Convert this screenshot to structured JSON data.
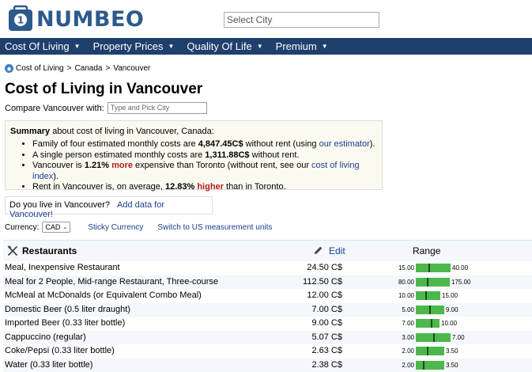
{
  "header": {
    "logo_text": "NUMBEO",
    "select_city_placeholder": "Select City"
  },
  "nav": [
    {
      "label": "Cost Of Living"
    },
    {
      "label": "Property Prices"
    },
    {
      "label": "Quality Of Life"
    },
    {
      "label": "Premium"
    }
  ],
  "breadcrumb": [
    "Cost of Living",
    "Canada",
    "Vancouver"
  ],
  "page_title": "Cost of Living in Vancouver",
  "compare": {
    "label": "Compare Vancouver with:",
    "placeholder": "Type and Pick City"
  },
  "summary": {
    "head_bold": "Summary",
    "head_rest": " about cost of living in Vancouver, Canada:",
    "b1_pre": "Family of four estimated monthly costs are ",
    "b1_value": "4,847.45C$",
    "b1_mid": " without rent (using ",
    "b1_link": "our estimator",
    "b1_post": ").",
    "b2_pre": "A single person estimated monthly costs are ",
    "b2_value": "1,311.88C$",
    "b2_post": " without rent.",
    "b3_pre": "Vancouver is ",
    "b3_pct": "1.21%",
    "b3_word": "more",
    "b3_mid": " expensive than Toronto (without rent, see our ",
    "b3_link": "cost of living index",
    "b3_post": ").",
    "b4_pre": "Rent in Vancouver is, on average, ",
    "b4_pct": "12.83%",
    "b4_word": "higher",
    "b4_post": " than in Toronto."
  },
  "live_box": {
    "question": "Do you live in Vancouver?",
    "link": "Add data for Vancouver!"
  },
  "currency": {
    "label": "Currency:",
    "selected": "CAD",
    "sticky_link": "Sticky Currency",
    "units_link": "Switch to US measurement units"
  },
  "table": {
    "section_title": "Restaurants",
    "edit_label": "Edit",
    "range_label": "Range",
    "rows": [
      {
        "name": "Meal, Inexpensive Restaurant",
        "price": "24.50 C$",
        "min": "15.00",
        "max": "40.00",
        "min_v": 15.0,
        "max_v": 40.0,
        "avg_v": 24.5
      },
      {
        "name": "Meal for 2 People, Mid-range Restaurant, Three-course",
        "price": "112.50 C$",
        "min": "80.00",
        "max": "175.00",
        "min_v": 80.0,
        "max_v": 175.0,
        "avg_v": 112.5
      },
      {
        "name": "McMeal at McDonalds (or Equivalent Combo Meal)",
        "price": "12.00 C$",
        "min": "10.00",
        "max": "15.00",
        "min_v": 10.0,
        "max_v": 15.0,
        "avg_v": 12.0
      },
      {
        "name": "Domestic Beer (0.5 liter draught)",
        "price": "7.00 C$",
        "min": "5.00",
        "max": "9.00",
        "min_v": 5.0,
        "max_v": 9.0,
        "avg_v": 7.0
      },
      {
        "name": "Imported Beer (0.33 liter bottle)",
        "price": "9.00 C$",
        "min": "7.00",
        "max": "10.00",
        "min_v": 7.0,
        "max_v": 10.0,
        "avg_v": 9.0
      },
      {
        "name": "Cappuccino (regular)",
        "price": "5.07 C$",
        "min": "3.00",
        "max": "7.00",
        "min_v": 3.0,
        "max_v": 7.0,
        "avg_v": 5.07
      },
      {
        "name": "Coke/Pepsi (0.33 liter bottle)",
        "price": "2.63 C$",
        "min": "2.00",
        "max": "3.50",
        "min_v": 2.0,
        "max_v": 3.5,
        "avg_v": 2.63
      },
      {
        "name": "Water (0.33 liter bottle)",
        "price": "2.38 C$",
        "min": "2.00",
        "max": "3.50",
        "min_v": 2.0,
        "max_v": 3.5,
        "avg_v": 2.38
      }
    ]
  },
  "colors": {
    "brand": "#2c5a8c",
    "nav_bg": "#1f3f6d",
    "link": "#1a3e91",
    "range_bar": "#4cb84c",
    "highlight_red": "#b71c1c"
  }
}
